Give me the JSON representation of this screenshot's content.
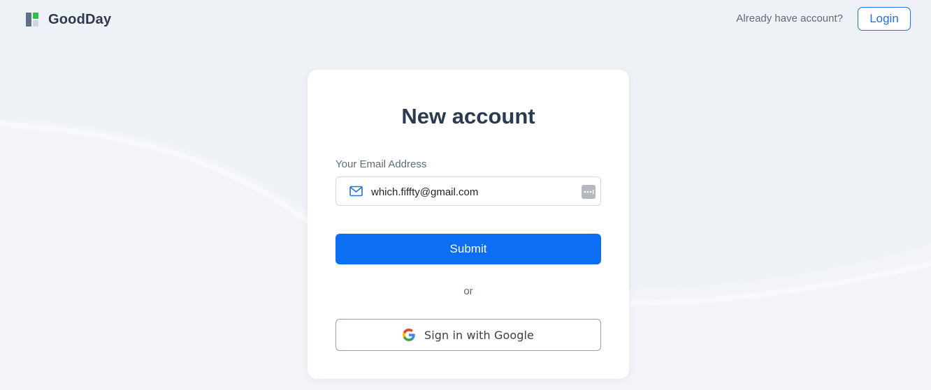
{
  "brand": {
    "name": "GoodDay",
    "icon": "goodday-logo-icon"
  },
  "header": {
    "prompt": "Already have account?",
    "login_label": "Login"
  },
  "form": {
    "title": "New account",
    "email_label": "Your Email Address",
    "email_value": "which.fiffty@gmail.com",
    "email_icon": "mail-icon",
    "autofill_icon": "password-manager-icon",
    "submit_label": "Submit",
    "divider_text": "or",
    "google_label": "Sign in with Google",
    "google_icon": "google-icon"
  },
  "colors": {
    "accent": "#0b6ef3",
    "login_border": "#1a73e8",
    "background": "#eef1f6",
    "title": "#2a3a50"
  }
}
